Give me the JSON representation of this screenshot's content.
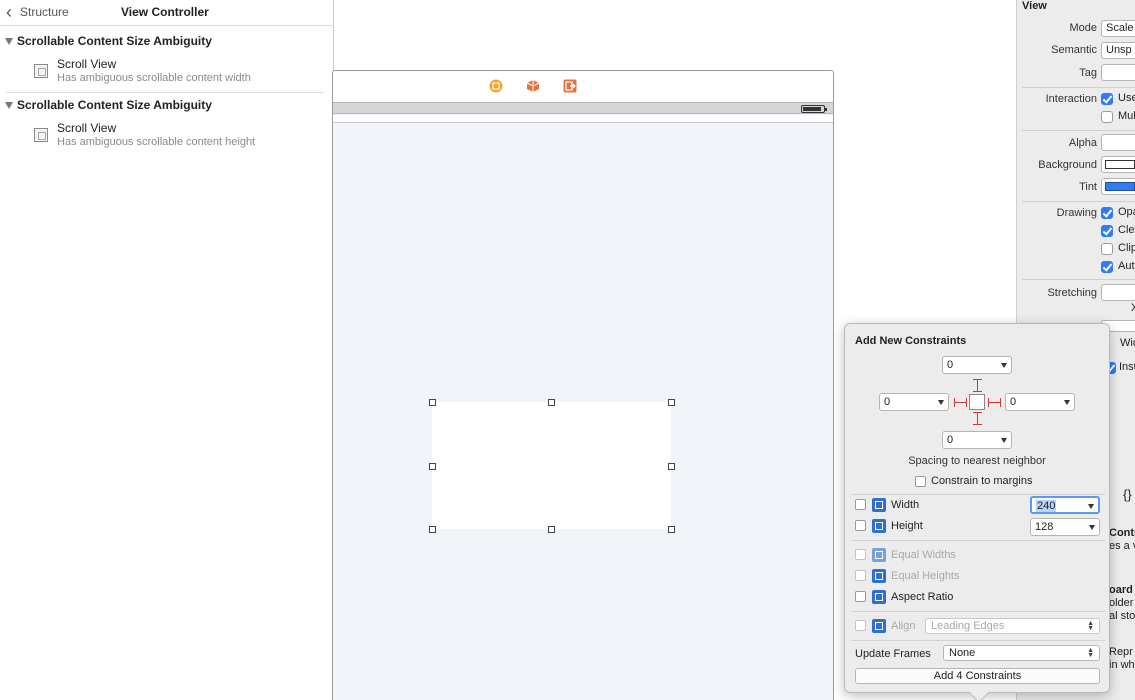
{
  "navigator": {
    "back_label": "Structure",
    "header_title": "View Controller",
    "groups": [
      {
        "title": "Scrollable Content Size Ambiguity",
        "item_title": "Scroll View",
        "item_subtitle": "Has ambiguous scrollable content width"
      },
      {
        "title": "Scrollable Content Size Ambiguity",
        "item_title": "Scroll View",
        "item_subtitle": "Has ambiguous scrollable content height"
      }
    ]
  },
  "canvas": {
    "scene_icons": [
      "view-controller-icon",
      "first-responder-icon",
      "exit-icon"
    ],
    "accent_colors": {
      "vc": "#f5a623",
      "responder": "#e0743a",
      "exit": "#e0743a"
    }
  },
  "inspector": {
    "section_title": "View",
    "mode_label": "Mode",
    "mode_value": "Scale",
    "semantic_label": "Semantic",
    "semantic_value": "Unsp",
    "tag_label": "Tag",
    "interaction_label": "Interaction",
    "interaction_opt1": "Use",
    "interaction_opt2": "Mul",
    "alpha_label": "Alpha",
    "background_label": "Background",
    "tint_label": "Tint",
    "drawing_label": "Drawing",
    "drawing_opt1": "Opa",
    "drawing_opt2": "Cle",
    "drawing_opt3": "Clip",
    "drawing_opt4": "Aut",
    "stretching_label": "Stretching",
    "x_label": "X",
    "wid_label": "Wid",
    "inst_label": "Inst",
    "braces": "{}",
    "frag_contr": "Contr",
    "frag_es": "es a v",
    "frag_oard": "oard",
    "frag_older": "older",
    "frag_al_stor": "al stor",
    "frag_repr": "Repr",
    "frag_in_wh": "in wh"
  },
  "popover": {
    "title": "Add New Constraints",
    "top_value": "0",
    "left_value": "0",
    "right_value": "0",
    "bottom_value": "0",
    "spacing_label": "Spacing to nearest neighbor",
    "constrain_margins": "Constrain to margins",
    "width_label": "Width",
    "width_value": "240",
    "height_label": "Height",
    "height_value": "128",
    "equal_widths": "Equal Widths",
    "equal_heights": "Equal Heights",
    "aspect_ratio": "Aspect Ratio",
    "align_label": "Align",
    "align_value": "Leading Edges",
    "update_frames_label": "Update Frames",
    "update_frames_value": "None",
    "add_button": "Add 4 Constraints"
  }
}
